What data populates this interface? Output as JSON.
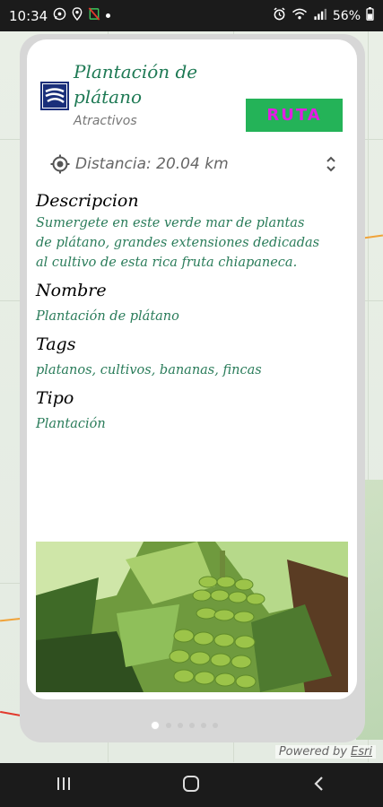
{
  "status_bar": {
    "time": "10:34",
    "battery": "56%"
  },
  "card": {
    "title_line1": "Plantación de",
    "title_line2": "plátano",
    "subtitle": "Atractivos",
    "route_button": "RUTA",
    "distance_label": "Distancia: 20.04 km",
    "sections": [
      {
        "title": "Descripcion",
        "body": "Sumergete en este verde mar de plantas de plátano, grandes extensiones dedicadas al cultivo de esta rica fruta chiapaneca."
      },
      {
        "title": "Nombre",
        "body": "Plantación de plátano"
      },
      {
        "title": "Tags",
        "body": "platanos, cultivos, bananas, fincas"
      },
      {
        "title": "Tipo",
        "body": "Plantación"
      }
    ]
  },
  "pager": {
    "count": 6,
    "active": 0
  },
  "attribution": {
    "prefix": "Powered by ",
    "brand": "Esri"
  },
  "colors": {
    "accent_green": "#24b358",
    "text_green": "#2a7c5a",
    "ruta_text": "#e21de3"
  },
  "icons": [
    "whatsapp-icon",
    "location-icon",
    "no-sim-icon",
    "alarm-icon",
    "wifi-icon",
    "signal-icon",
    "battery-icon",
    "map-pin-icon",
    "chevron-updown-icon",
    "recents-icon",
    "home-icon",
    "back-icon"
  ]
}
